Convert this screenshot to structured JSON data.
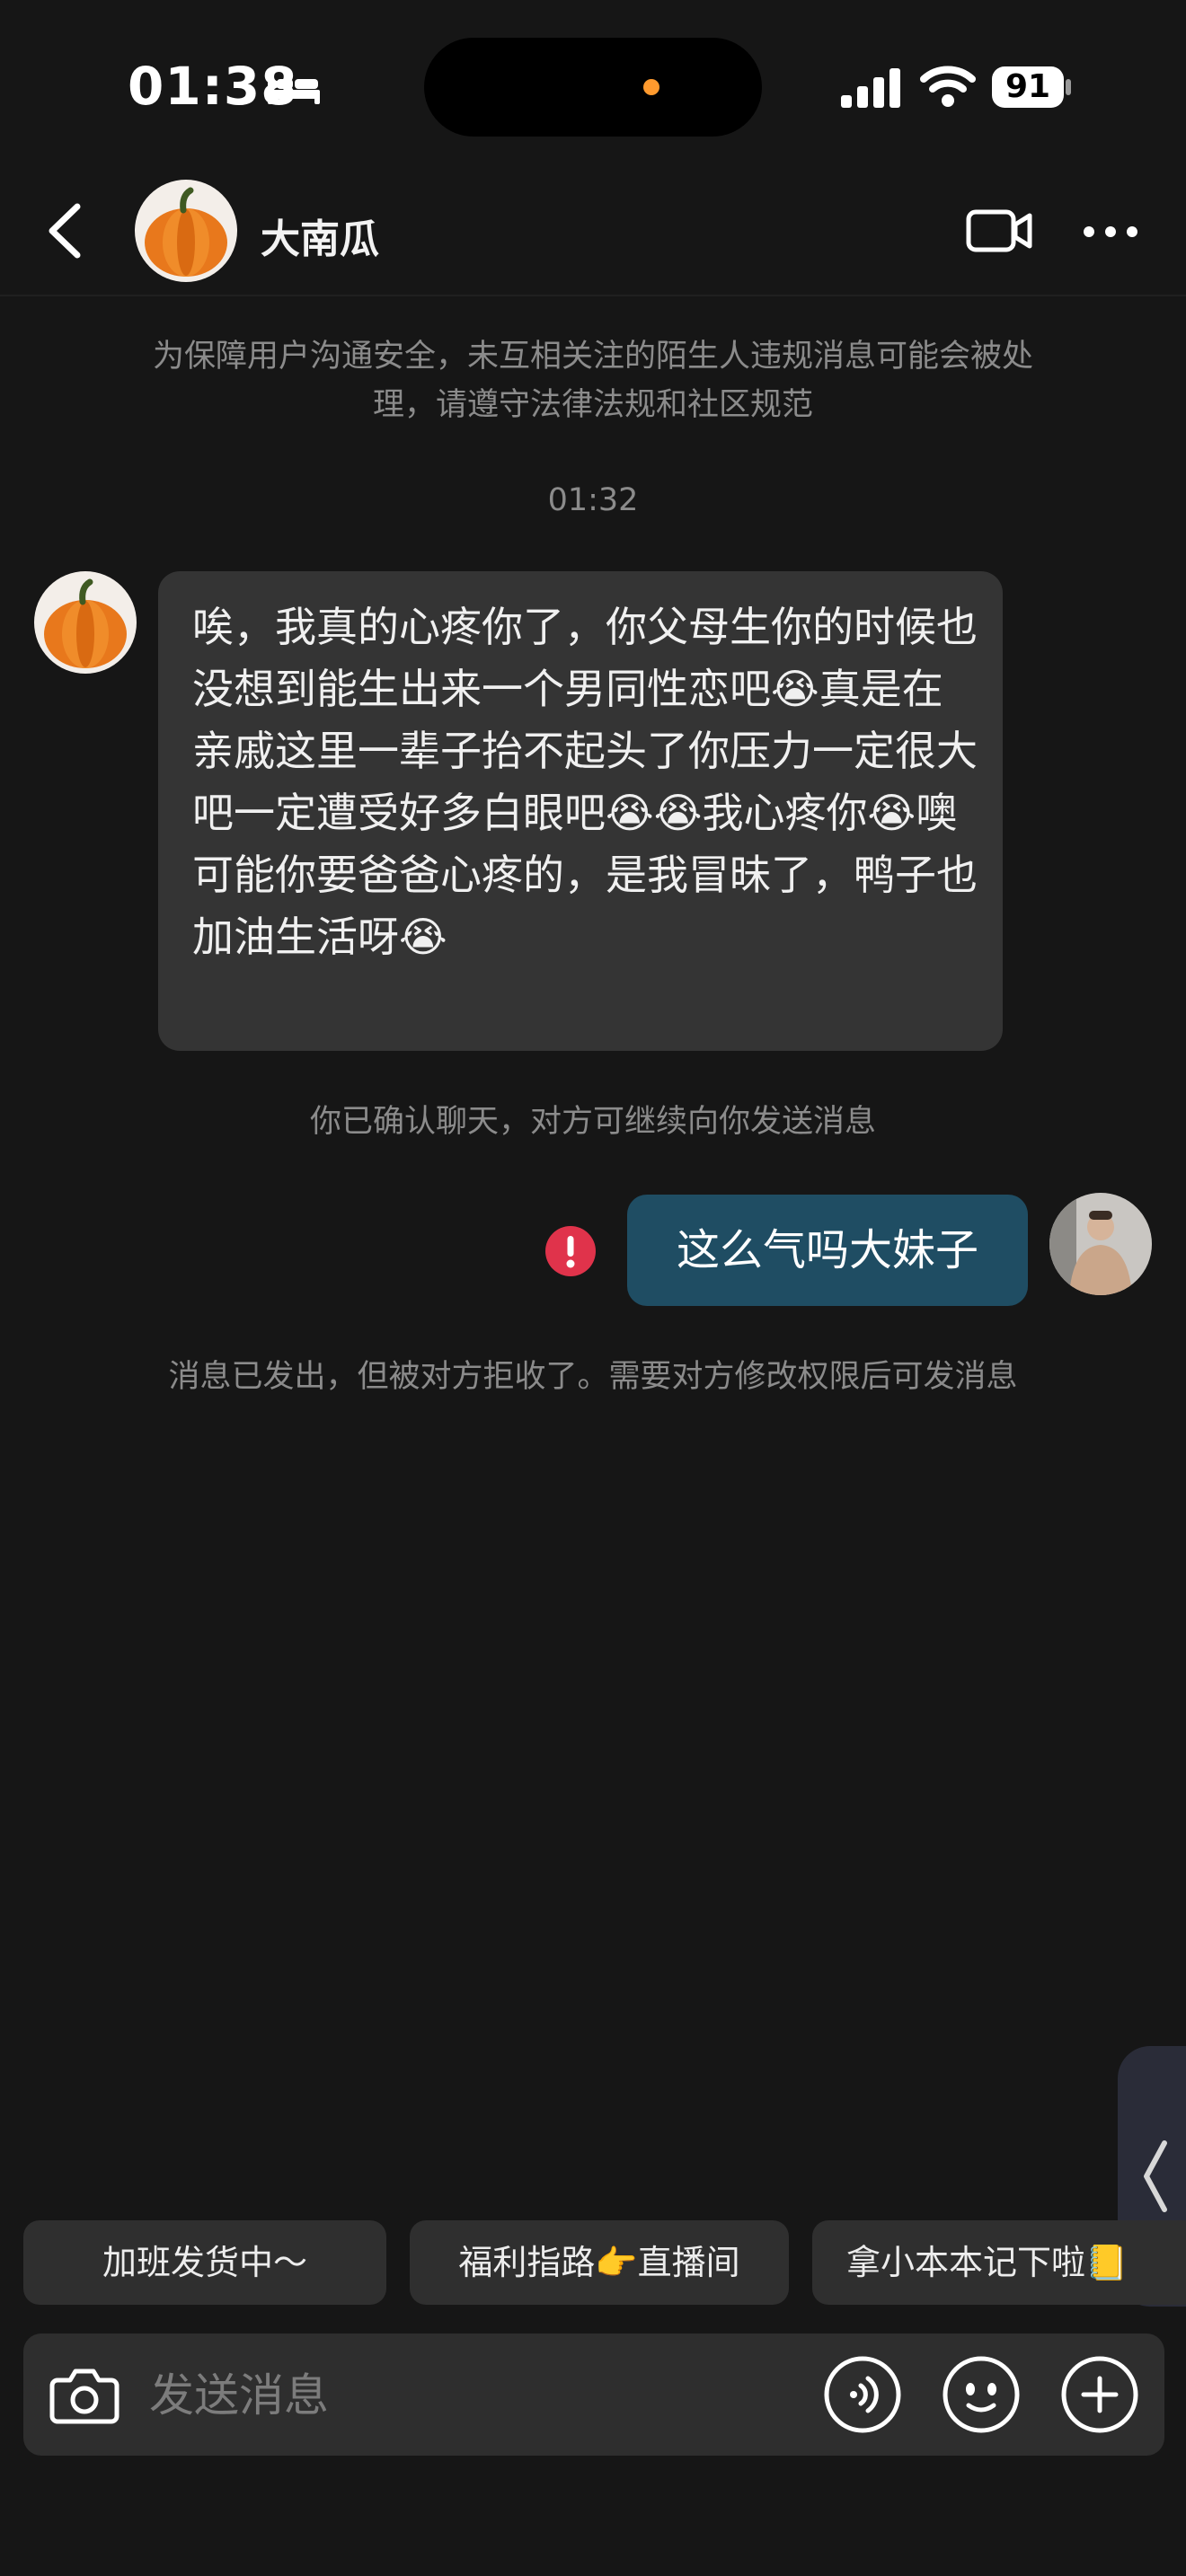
{
  "status_bar": {
    "time": "01:38",
    "battery": "91"
  },
  "header": {
    "contact_name": "大南瓜"
  },
  "messages": {
    "security_notice": "为保障用户沟通安全，未互相关注的陌生人违规消息可能会被处理，请遵守法律法规和社区规范",
    "timestamp": "01:32",
    "incoming_text": "唉，我真的心疼你了，你父母生你的时候也没想到能生出来一个男同性恋吧😭真是在亲戚这里一辈子抬不起头了你压力一定很大吧一定遭受好多白眼吧😭😭我心疼你😭噢可能你要爸爸心疼的，是我冒昧了，鸭子也加油生活呀😭",
    "confirm_notice": "你已确认聊天，对方可继续向你发送消息",
    "outgoing_text": "这么气吗大妹子",
    "rejected_notice": "消息已发出，但被对方拒收了。需要对方修改权限后可发消息"
  },
  "quick_replies": [
    "加班发货中～",
    "福利指路👉直播间",
    "拿小本本记下啦📒"
  ],
  "input": {
    "placeholder": "发送消息"
  },
  "colors": {
    "background": "#161616",
    "incoming_bubble": "#343434",
    "outgoing_bubble": "#1f4d63",
    "error": "#e0334b"
  }
}
